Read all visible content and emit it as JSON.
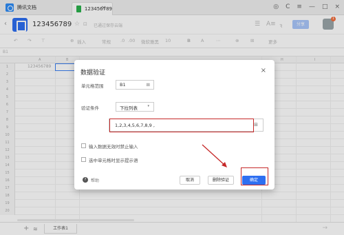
{
  "titlebar": {
    "app_name": "腾讯文档",
    "doc_tab": "123456789",
    "tab_close": "×",
    "window_controls": [
      "◎",
      "C",
      "≡",
      "—",
      "□",
      "×"
    ]
  },
  "docbar": {
    "back": "‹",
    "doc_name": "123456789",
    "star": "☆",
    "cloud": "⊡",
    "saved_text": "已通过保存云端",
    "icons": [
      "☰",
      "A≡",
      "ꝛ"
    ],
    "share_label": "分享",
    "avatar_badge": "1"
  },
  "toolbar": {
    "items": [
      "↶",
      "↷",
      "⊤",
      "⊕",
      "插入",
      "常规",
      ".0",
      ".00",
      "微软雅黑",
      "10",
      "B",
      "A",
      "⋯",
      "⊗",
      "⊞",
      "更多"
    ]
  },
  "formula_bar": {
    "cell_ref": "B1"
  },
  "grid": {
    "columns": [
      "A",
      "B",
      "H",
      "I"
    ],
    "rows": [
      "1",
      "2",
      "3",
      "4",
      "5",
      "6",
      "7",
      "8",
      "9",
      "10",
      "11",
      "12",
      "13",
      "14",
      "15",
      "16",
      "17",
      "18",
      "19",
      "20"
    ],
    "cell_a1": "123456789"
  },
  "sheets": {
    "add": "+",
    "list_icon": "≋",
    "active": "工作表1",
    "nav_arrow": "→"
  },
  "dialog": {
    "title": "数据验证",
    "close": "×",
    "range_label": "单元格范围",
    "range_value": "B1",
    "range_icon": "⊞",
    "criteria_label": "验证条件",
    "criteria_value": "下拉列表",
    "criteria_caret": "▾",
    "list_value": "1,2,3,4,5,6,7,8,9 ,",
    "list_icon": "⊞",
    "checkbox1_label": "输入数据无效时禁止输入",
    "checkbox2_label": "选中单元格时显示提示语",
    "help_icon": "?",
    "help_label": "帮助",
    "cancel_label": "取消",
    "delete_label": "删除验证",
    "confirm_label": "确定"
  },
  "colors": {
    "accent": "#2e6ff1",
    "highlight": "#c62828",
    "active_sheet_tab_icon": "#2bb14d"
  }
}
